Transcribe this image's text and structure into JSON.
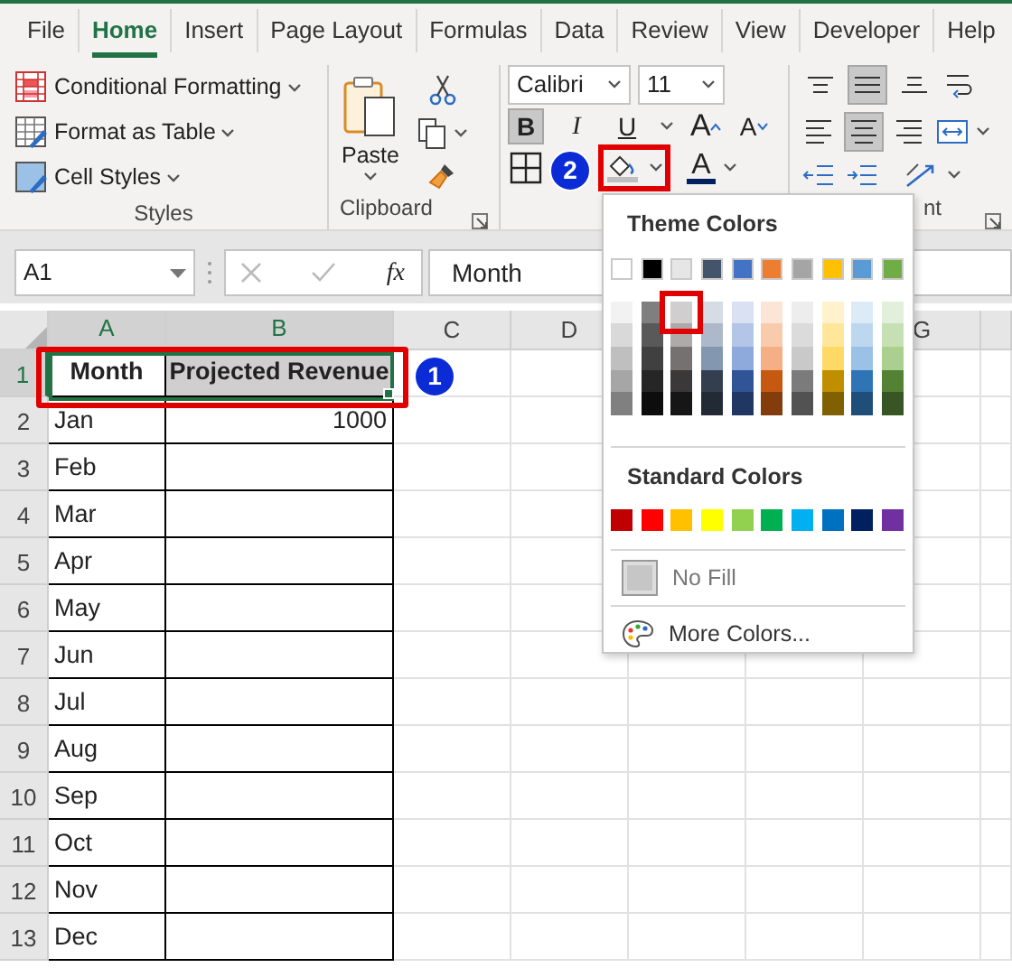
{
  "tabs": [
    {
      "label": "File",
      "selected": false
    },
    {
      "label": "Home",
      "selected": true
    },
    {
      "label": "Insert",
      "selected": false
    },
    {
      "label": "Page Layout",
      "selected": false
    },
    {
      "label": "Formulas",
      "selected": false
    },
    {
      "label": "Data",
      "selected": false
    },
    {
      "label": "Review",
      "selected": false
    },
    {
      "label": "View",
      "selected": false
    },
    {
      "label": "Developer",
      "selected": false
    },
    {
      "label": "Help",
      "selected": false
    }
  ],
  "styles_group": {
    "label": "Styles",
    "items": [
      "Conditional Formatting",
      "Format as Table",
      "Cell Styles"
    ]
  },
  "clipboard_group": {
    "label": "Clipboard",
    "paste": "Paste"
  },
  "font_group": {
    "font_name": "Calibri",
    "font_size": "11",
    "style_buttons": [
      {
        "label": "B",
        "selected": true
      },
      {
        "label": "I",
        "selected": false
      },
      {
        "label": "U",
        "selected": false
      }
    ],
    "size_buttons": [
      "A",
      "A"
    ],
    "font_color_label": "A",
    "fill_highlighted": true
  },
  "alignment_group": {
    "label": "nt",
    "vertical": [
      {
        "selected": false
      },
      {
        "selected": true
      },
      {
        "selected": false
      }
    ],
    "horizontal": [
      {
        "selected": false
      },
      {
        "selected": true
      },
      {
        "selected": false
      }
    ]
  },
  "formula_bar": {
    "name_box": "A1",
    "fx": "fx",
    "content": "Month"
  },
  "sheet": {
    "columns": [
      {
        "label": "A",
        "selected": true
      },
      {
        "label": "B",
        "selected": true
      },
      {
        "label": "C",
        "selected": false
      },
      {
        "label": "D",
        "selected": false
      }
    ],
    "columns_right": [
      {
        "label": "G",
        "selected": false
      }
    ],
    "selection_highlighted": true,
    "rows": [
      {
        "number": "1",
        "selected": true,
        "cells": [
          {
            "text": "Month",
            "kind": "header"
          },
          {
            "text": "Projected Revenue",
            "kind": "header",
            "color": "#d0cece"
          }
        ]
      },
      {
        "number": "2",
        "selected": false,
        "cells": [
          {
            "text": "Jan",
            "kind": "text"
          },
          {
            "text": "1000",
            "kind": "number"
          }
        ]
      },
      {
        "number": "3",
        "selected": false,
        "cells": [
          {
            "text": "Feb",
            "kind": "text"
          },
          {}
        ]
      },
      {
        "number": "4",
        "selected": false,
        "cells": [
          {
            "text": "Mar",
            "kind": "text"
          },
          {}
        ]
      },
      {
        "number": "5",
        "selected": false,
        "cells": [
          {
            "text": "Apr",
            "kind": "text"
          },
          {}
        ]
      },
      {
        "number": "6",
        "selected": false,
        "cells": [
          {
            "text": "May",
            "kind": "text"
          },
          {}
        ]
      },
      {
        "number": "7",
        "selected": false,
        "cells": [
          {
            "text": "Jun",
            "kind": "text"
          },
          {}
        ]
      },
      {
        "number": "8",
        "selected": false,
        "cells": [
          {
            "text": "Jul",
            "kind": "text"
          },
          {}
        ]
      },
      {
        "number": "9",
        "selected": false,
        "cells": [
          {
            "text": "Aug",
            "kind": "text"
          },
          {}
        ]
      },
      {
        "number": "10",
        "selected": false,
        "cells": [
          {
            "text": "Sep",
            "kind": "text"
          },
          {}
        ]
      },
      {
        "number": "11",
        "selected": false,
        "cells": [
          {
            "text": "Oct",
            "kind": "text"
          },
          {}
        ]
      },
      {
        "number": "12",
        "selected": false,
        "cells": [
          {
            "text": "Nov",
            "kind": "text"
          },
          {}
        ]
      },
      {
        "number": "13",
        "selected": false,
        "cells": [
          {
            "text": "Dec",
            "kind": "text"
          },
          {}
        ]
      }
    ]
  },
  "fill_menu": {
    "theme_title": "Theme Colors",
    "theme_colors": [
      {
        "color": "#ffffff",
        "selected": false
      },
      {
        "color": "#000000",
        "selected": false
      },
      {
        "color": "#e7e6e6",
        "selected": false
      },
      {
        "color": "#44546a",
        "selected": false
      },
      {
        "color": "#4472c4",
        "selected": false
      },
      {
        "color": "#ed7d31",
        "selected": false
      },
      {
        "color": "#a5a5a5",
        "selected": false
      },
      {
        "color": "#ffc000",
        "selected": false
      },
      {
        "color": "#5b9bd5",
        "selected": false
      },
      {
        "color": "#70ad47",
        "selected": false
      }
    ],
    "theme_shades": [
      {
        "shades": [
          {
            "color": "#f2f2f2",
            "selected": false
          },
          {
            "color": "#d9d9d9",
            "selected": false
          },
          {
            "color": "#bfbfbf",
            "selected": false
          },
          {
            "color": "#a6a6a6",
            "selected": false
          },
          {
            "color": "#808080",
            "selected": false
          }
        ]
      },
      {
        "shades": [
          {
            "color": "#7f7f7f",
            "selected": false
          },
          {
            "color": "#595959",
            "selected": false
          },
          {
            "color": "#404040",
            "selected": false
          },
          {
            "color": "#262626",
            "selected": false
          },
          {
            "color": "#0d0d0d",
            "selected": false
          }
        ]
      },
      {
        "shades": [
          {
            "color": "#d0cece",
            "selected": true
          },
          {
            "color": "#aeaaaa",
            "selected": false
          },
          {
            "color": "#757171",
            "selected": false
          },
          {
            "color": "#3a3838",
            "selected": false
          },
          {
            "color": "#171616",
            "selected": false
          }
        ]
      },
      {
        "shades": [
          {
            "color": "#d6dce4",
            "selected": false
          },
          {
            "color": "#adb9ca",
            "selected": false
          },
          {
            "color": "#8497b0",
            "selected": false
          },
          {
            "color": "#333f4f",
            "selected": false
          },
          {
            "color": "#222b35",
            "selected": false
          }
        ]
      },
      {
        "shades": [
          {
            "color": "#d9e1f2",
            "selected": false
          },
          {
            "color": "#b4c6e7",
            "selected": false
          },
          {
            "color": "#8ea9db",
            "selected": false
          },
          {
            "color": "#305496",
            "selected": false
          },
          {
            "color": "#203764",
            "selected": false
          }
        ]
      },
      {
        "shades": [
          {
            "color": "#fce4d6",
            "selected": false
          },
          {
            "color": "#f8cbad",
            "selected": false
          },
          {
            "color": "#f4b084",
            "selected": false
          },
          {
            "color": "#c65911",
            "selected": false
          },
          {
            "color": "#833c0c",
            "selected": false
          }
        ]
      },
      {
        "shades": [
          {
            "color": "#ededed",
            "selected": false
          },
          {
            "color": "#dbdbdb",
            "selected": false
          },
          {
            "color": "#c9c9c9",
            "selected": false
          },
          {
            "color": "#7b7b7b",
            "selected": false
          },
          {
            "color": "#525252",
            "selected": false
          }
        ]
      },
      {
        "shades": [
          {
            "color": "#fff2cc",
            "selected": false
          },
          {
            "color": "#ffe699",
            "selected": false
          },
          {
            "color": "#ffd966",
            "selected": false
          },
          {
            "color": "#bf8f00",
            "selected": false
          },
          {
            "color": "#806000",
            "selected": false
          }
        ]
      },
      {
        "shades": [
          {
            "color": "#ddebf7",
            "selected": false
          },
          {
            "color": "#bdd7ee",
            "selected": false
          },
          {
            "color": "#9bc2e6",
            "selected": false
          },
          {
            "color": "#2f75b5",
            "selected": false
          },
          {
            "color": "#1f4e78",
            "selected": false
          }
        ]
      },
      {
        "shades": [
          {
            "color": "#e2efda",
            "selected": false
          },
          {
            "color": "#c6e0b4",
            "selected": false
          },
          {
            "color": "#a9d08e",
            "selected": false
          },
          {
            "color": "#548235",
            "selected": false
          },
          {
            "color": "#375623",
            "selected": false
          }
        ]
      }
    ],
    "standard_title": "Standard Colors",
    "standard_colors": [
      {
        "color": "#c00000",
        "selected": false
      },
      {
        "color": "#ff0000",
        "selected": false
      },
      {
        "color": "#ffc000",
        "selected": false
      },
      {
        "color": "#ffff00",
        "selected": false
      },
      {
        "color": "#92d050",
        "selected": false
      },
      {
        "color": "#00b050",
        "selected": false
      },
      {
        "color": "#00b0f0",
        "selected": false
      },
      {
        "color": "#0070c0",
        "selected": false
      },
      {
        "color": "#002060",
        "selected": false
      },
      {
        "color": "#7030a0",
        "selected": false
      }
    ],
    "no_fill": "No Fill",
    "more_colors": "More Colors..."
  },
  "annotations": [
    {
      "number": "1"
    },
    {
      "number": "2"
    }
  ]
}
